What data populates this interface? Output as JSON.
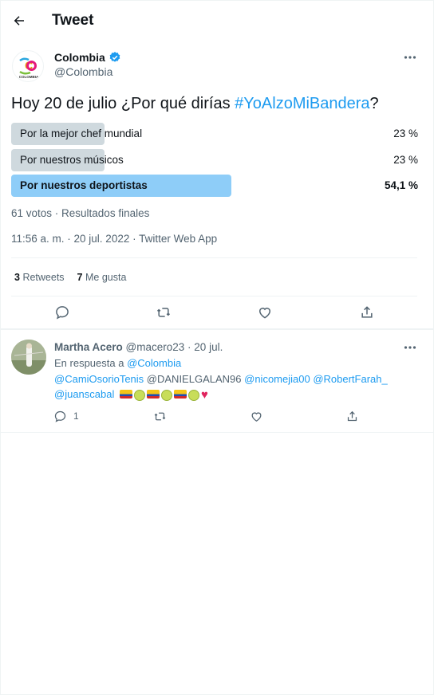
{
  "header": {
    "title": "Tweet"
  },
  "author": {
    "name": "Colombia",
    "handle": "@Colombia",
    "verified": true,
    "logo_text": "CO",
    "logo_sub": "COLOMBIA"
  },
  "tweet": {
    "text_prefix": "Hoy 20 de julio ¿Por qué dirías ",
    "hashtag": "#YoAlzoMiBandera",
    "text_suffix": "?"
  },
  "poll": {
    "options": [
      {
        "label": "Por la mejor chef mundial",
        "percent": "23 %",
        "fraction": 0.23,
        "winner": false
      },
      {
        "label": "Por nuestros músicos",
        "percent": "23 %",
        "fraction": 0.23,
        "winner": false
      },
      {
        "label": "Por nuestros deportistas",
        "percent": "54,1 %",
        "fraction": 0.541,
        "winner": true
      }
    ],
    "summary": "61 votos · Resultados finales"
  },
  "timestamp": "11:56 a. m. · 20 jul. 2022 · Twitter Web App",
  "stats": {
    "retweets_count": "3",
    "retweets_label": "Retweets",
    "likes_count": "7",
    "likes_label": "Me gusta"
  },
  "icons": [
    "back-arrow-icon",
    "verified-badge-icon",
    "more-icon",
    "reply-icon",
    "retweet-icon",
    "like-icon",
    "share-icon"
  ],
  "colors": {
    "accent": "#1d9bf0",
    "poll_bar": "#cfd9de",
    "poll_winner": "#8ecdf8",
    "secondary_text": "#536471"
  },
  "reply": {
    "name": "Martha Acero",
    "handle": "@macero23",
    "date": "20 jul.",
    "in_reply_label": "En respuesta a",
    "in_reply_handle": "@Colombia",
    "mention1": "@CamiOsorioTenis",
    "mention2": "@DANIELGALAN96",
    "mention3": "@nicomejia00",
    "mention4": "@RobertFarah_",
    "mention5": "@juanscabal",
    "reply_count": "1"
  }
}
